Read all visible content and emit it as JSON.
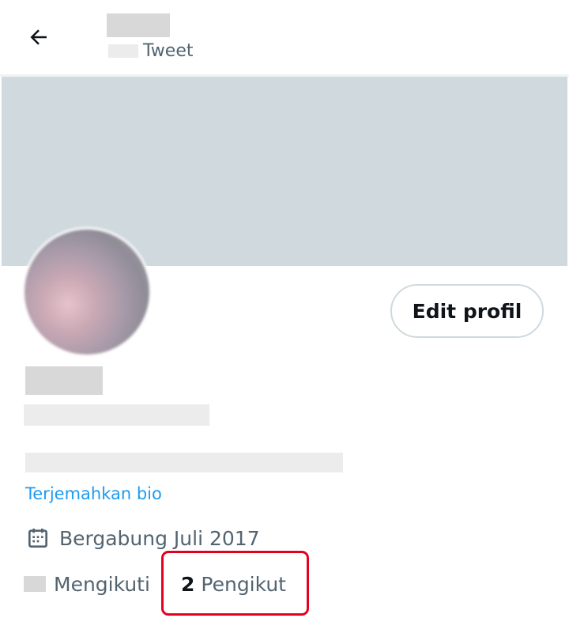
{
  "header": {
    "tweets_label": "Tweet"
  },
  "profile": {
    "edit_button": "Edit profil",
    "translate_bio": "Terjemahkan bio",
    "joined": "Bergabung Juli 2017",
    "following_label": "Mengikuti",
    "followers_count": "2",
    "followers_label": "Pengikut"
  },
  "icons": {
    "back": "arrow-left-icon",
    "joined": "calendar-icon"
  },
  "colors": {
    "link": "#1d9bf0",
    "banner": "#cfd9de",
    "secondary_text": "#536471",
    "highlight": "#e5001f"
  }
}
